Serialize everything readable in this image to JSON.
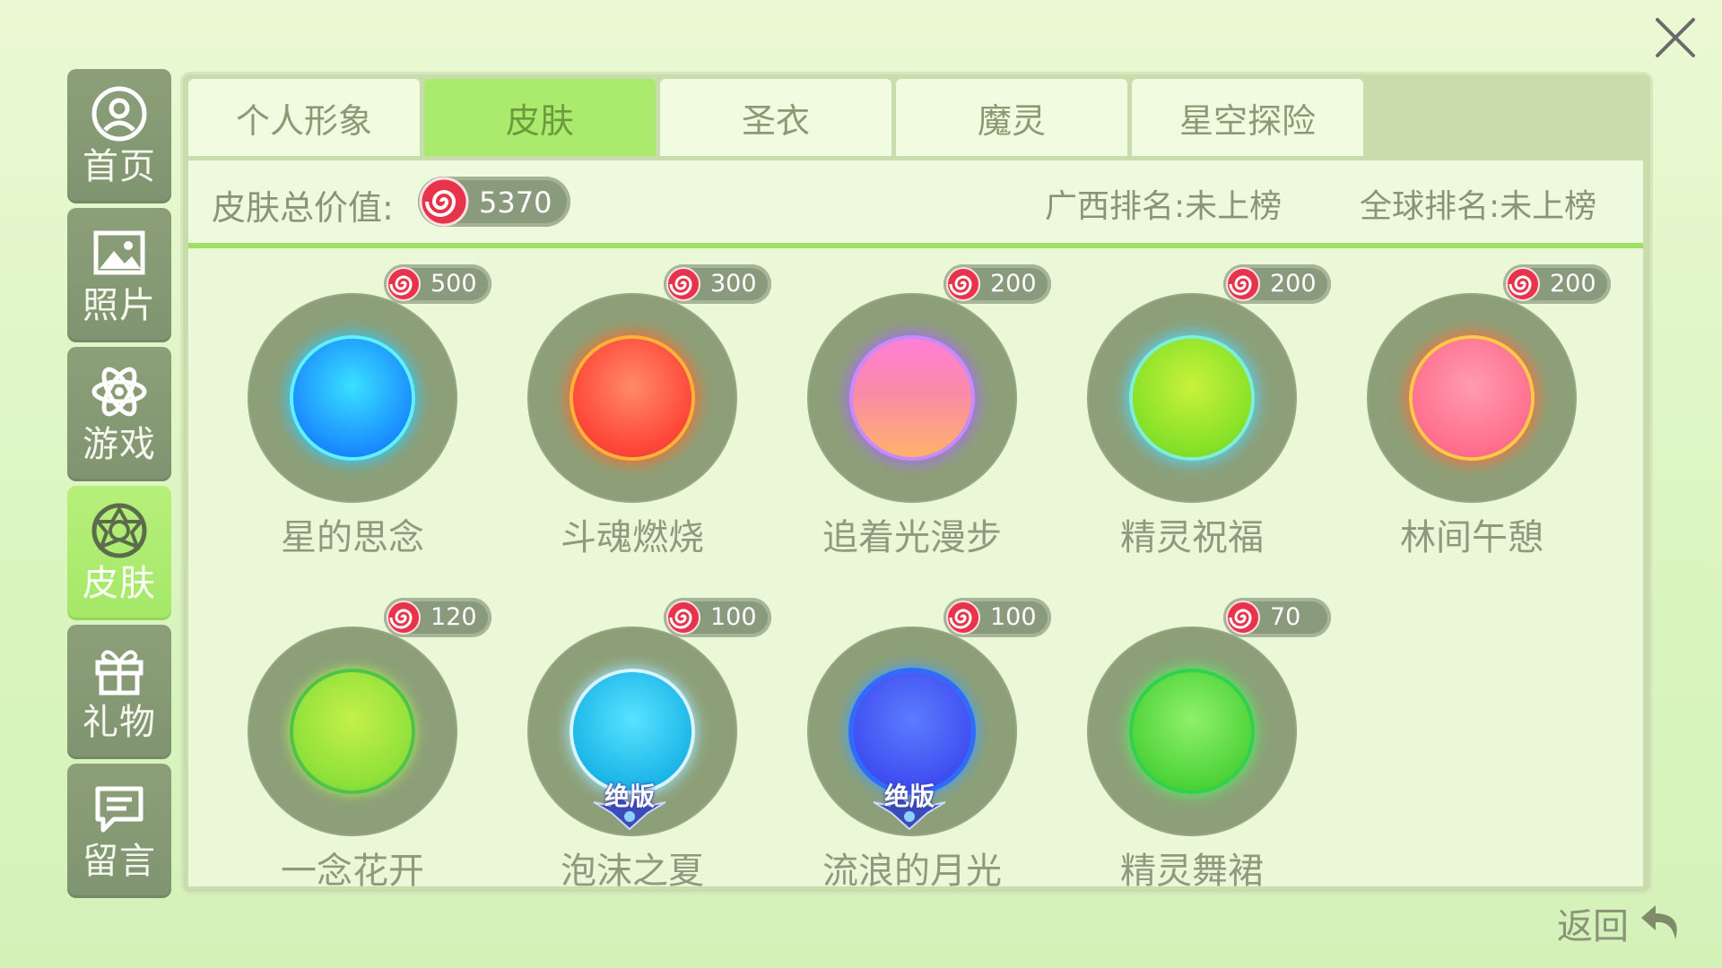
{
  "sidebar": {
    "items": [
      {
        "label": "首页",
        "icon": "user-icon",
        "active": false
      },
      {
        "label": "照片",
        "icon": "photo-icon",
        "active": false
      },
      {
        "label": "游戏",
        "icon": "atom-icon",
        "active": false
      },
      {
        "label": "皮肤",
        "icon": "star-ring-icon",
        "active": true
      },
      {
        "label": "礼物",
        "icon": "gift-icon",
        "active": false
      },
      {
        "label": "留言",
        "icon": "message-icon",
        "active": false
      }
    ]
  },
  "tabs": [
    {
      "label": "个人形象",
      "active": false
    },
    {
      "label": "皮肤",
      "active": true
    },
    {
      "label": "圣衣",
      "active": false
    },
    {
      "label": "魔灵",
      "active": false
    },
    {
      "label": "星空探险",
      "active": false
    }
  ],
  "summary": {
    "total_label": "皮肤总价值:",
    "total_value": "5370",
    "rank_province": "广西排名:未上榜",
    "rank_global": "全球排名:未上榜"
  },
  "skins": [
    {
      "name": "星的思念",
      "price": "500",
      "jueban": ""
    },
    {
      "name": "斗魂燃烧",
      "price": "300",
      "jueban": ""
    },
    {
      "name": "追着光漫步",
      "price": "200",
      "jueban": ""
    },
    {
      "name": "精灵祝福",
      "price": "200",
      "jueban": ""
    },
    {
      "name": "林间午憩",
      "price": "200",
      "jueban": ""
    },
    {
      "name": "一念花开",
      "price": "120",
      "jueban": ""
    },
    {
      "name": "泡沫之夏",
      "price": "100",
      "jueban": "绝版"
    },
    {
      "name": "流浪的月光",
      "price": "100",
      "jueban": "绝版"
    },
    {
      "name": "精灵舞裙",
      "price": "70",
      "jueban": ""
    }
  ],
  "back": {
    "label": "返回",
    "icon": "back-arrow-icon"
  },
  "close": {
    "icon": "close-icon"
  },
  "colors": {
    "accent_green": "#aaea6c",
    "sidebar_bg": "#8c9f79",
    "text_muted": "#8b9378",
    "currency_red": "#e8344a"
  }
}
